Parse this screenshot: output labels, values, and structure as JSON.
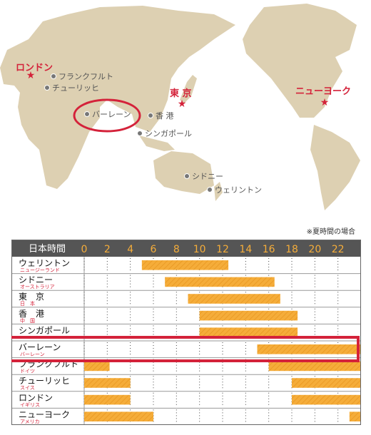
{
  "map": {
    "land_color": "#ddd0b2",
    "sea_color": "#ffffff",
    "major_cities": [
      {
        "name": "ロンドン",
        "id": "london"
      },
      {
        "name": "東 京",
        "id": "tokyo"
      },
      {
        "name": "ニューヨーク",
        "id": "newyork"
      }
    ],
    "cities": [
      {
        "name": "フランクフルト",
        "id": "frankfurt"
      },
      {
        "name": "チューリッヒ",
        "id": "zurich"
      },
      {
        "name": "バーレーン",
        "id": "bahrain"
      },
      {
        "name": "香 港",
        "id": "hongkong"
      },
      {
        "name": "シンガポール",
        "id": "singapore"
      },
      {
        "name": "シドニー",
        "id": "sydney"
      },
      {
        "name": "ウェリントン",
        "id": "wellington"
      }
    ],
    "highlight_color": "#d4223a"
  },
  "timetable": {
    "note": "※夏時間の場合",
    "header_label": "日本時間",
    "hour_labels": [
      "0",
      "2",
      "4",
      "6",
      "8",
      "10",
      "12",
      "14",
      "16",
      "18",
      "20",
      "22"
    ],
    "bar_color": "#f5ad3a",
    "header_color": "#555555",
    "highlight_row": "バーレーン",
    "rows": [
      {
        "city": "ウェリントン",
        "country": "ニュージーランド",
        "spans": [
          [
            5,
            12.5
          ]
        ]
      },
      {
        "city": "シドニー",
        "country": "オーストラリア",
        "spans": [
          [
            7,
            16.5
          ]
        ]
      },
      {
        "city": "東　京",
        "country": "日　本",
        "spans": [
          [
            9,
            17
          ]
        ]
      },
      {
        "city": "香　港",
        "country": "中　国",
        "spans": [
          [
            10,
            18.5
          ]
        ]
      },
      {
        "city": "シンガポール",
        "country": "",
        "spans": [
          [
            10,
            18.5
          ]
        ]
      },
      {
        "city": "バーレーン",
        "country": "バーレーン",
        "spans": [
          [
            15,
            24
          ]
        ]
      },
      {
        "city": "フランクフルト",
        "country": "ドイツ",
        "spans": [
          [
            0,
            2.2
          ],
          [
            16,
            24
          ]
        ]
      },
      {
        "city": "チューリッヒ",
        "country": "スイス",
        "spans": [
          [
            0,
            4
          ],
          [
            18,
            24
          ]
        ]
      },
      {
        "city": "ロンドン",
        "country": "イギリス",
        "spans": [
          [
            0,
            4
          ],
          [
            18,
            24
          ]
        ]
      },
      {
        "city": "ニューヨーク",
        "country": "アメリカ",
        "spans": [
          [
            0,
            6
          ],
          [
            23,
            24
          ]
        ]
      }
    ]
  }
}
